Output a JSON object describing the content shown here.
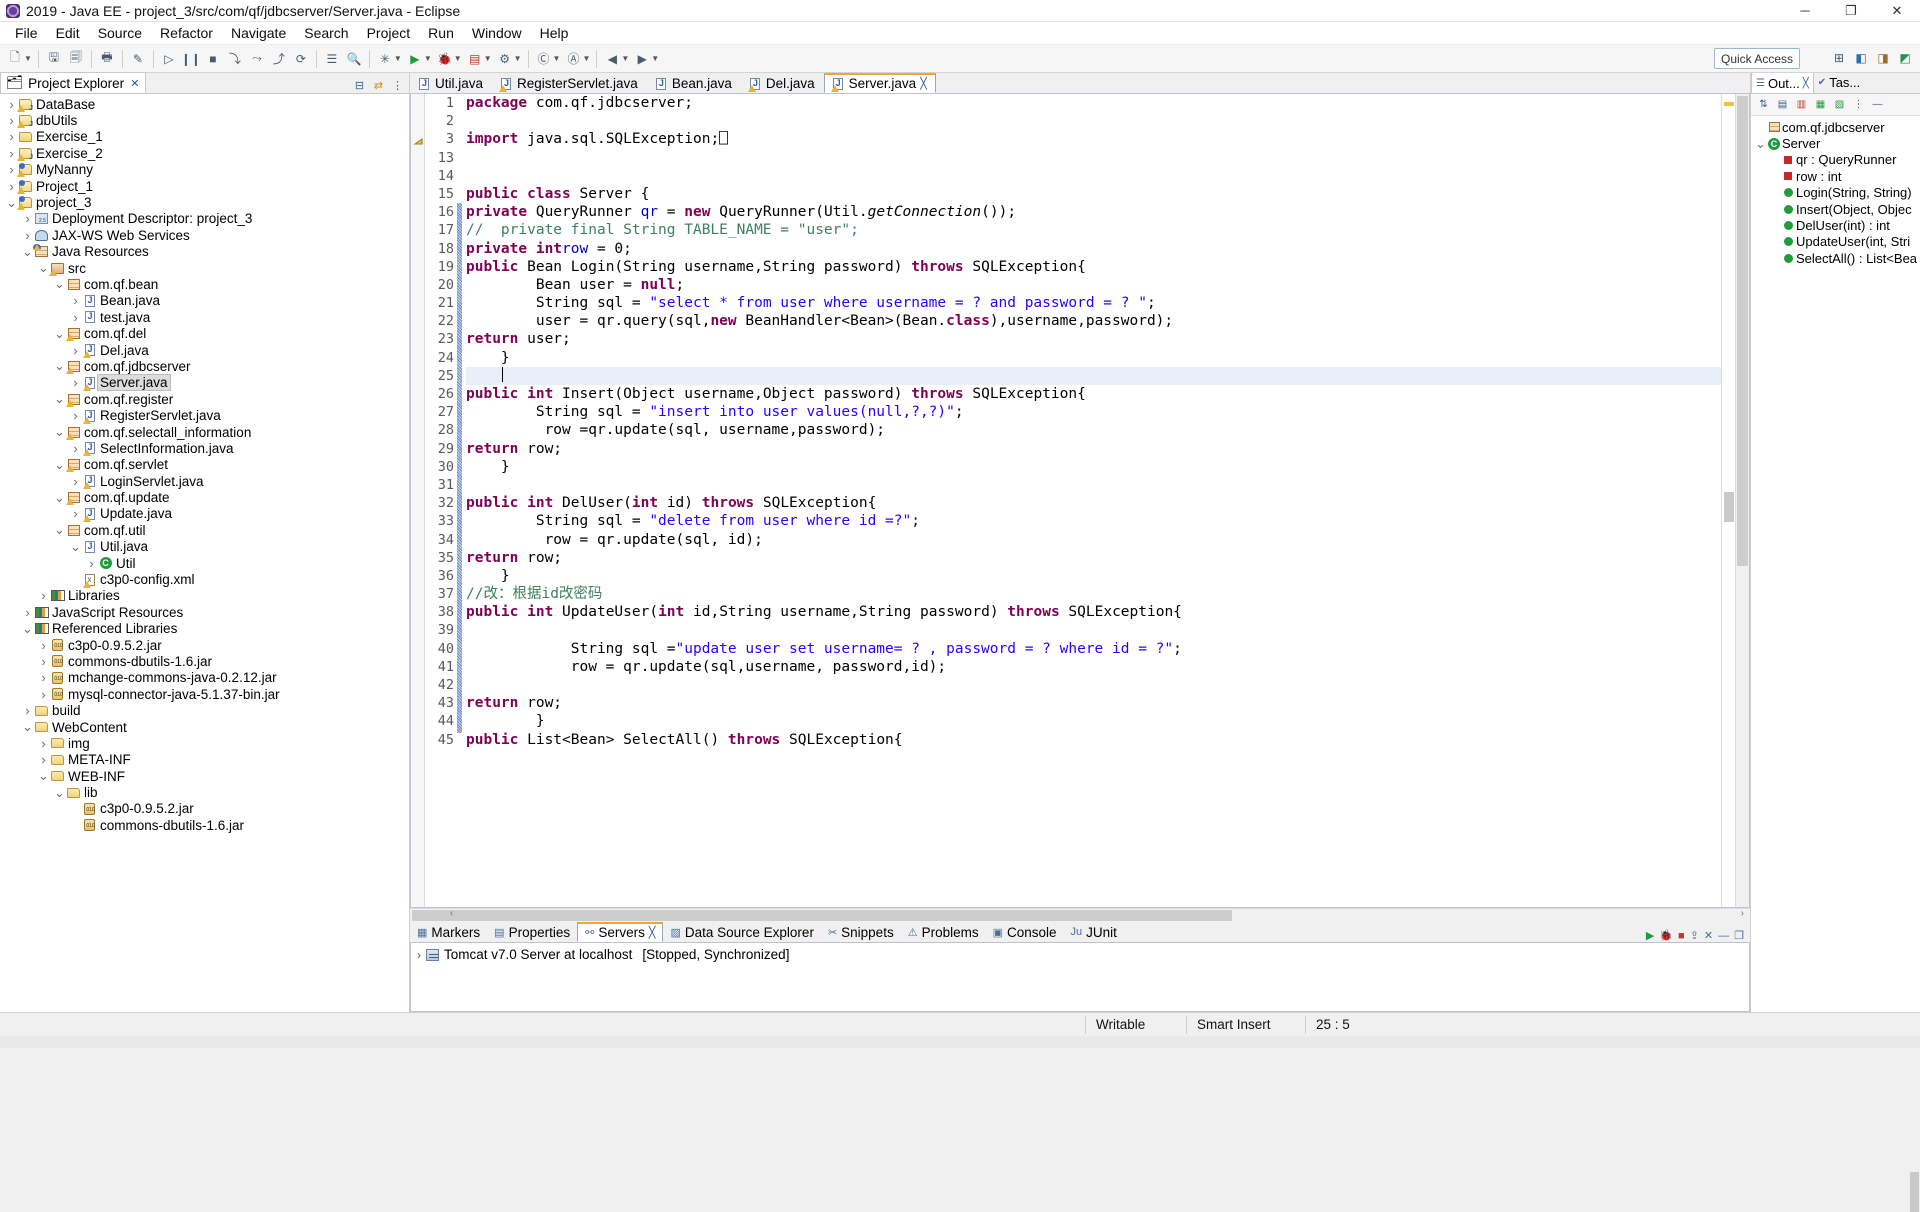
{
  "window": {
    "title": "2019 - Java EE - project_3/src/com/qf/jdbcserver/Server.java - Eclipse",
    "minimize": "─",
    "maximize": "❐",
    "close": "✕"
  },
  "menubar": [
    "File",
    "Edit",
    "Source",
    "Refactor",
    "Navigate",
    "Search",
    "Project",
    "Run",
    "Window",
    "Help"
  ],
  "toolbar": {
    "quick_access_placeholder": "Quick Access",
    "items": [
      "new-wizard-icon",
      "save-icon",
      "save-all-icon",
      "print-icon",
      "toggle-markoccurrences-icon",
      "debug-icon",
      "pause-icon",
      "stop-icon",
      "step-icon",
      "stepover-icon",
      "stepreturn-icon",
      "restart-icon",
      "open-type-icon",
      "search-icon",
      "new-java-package-icon",
      "run-icon",
      "debug-run-icon",
      "coverage-icon",
      "external-tools-icon",
      "new-java-class-icon",
      "back-icon",
      "forward-icon"
    ]
  },
  "explorer": {
    "tab_label": "Project Explorer",
    "tools": [
      "collapse-all-icon",
      "link-with-editor-icon",
      "view-menu-icon"
    ],
    "items": [
      {
        "label": "DataBase",
        "indent": 0,
        "arrow": "collapsed",
        "icon": "project-java-icon"
      },
      {
        "label": "dbUtils",
        "indent": 0,
        "arrow": "collapsed",
        "icon": "project-java-icon"
      },
      {
        "label": "Exercise_1",
        "indent": 0,
        "arrow": "collapsed",
        "icon": "folder-icon"
      },
      {
        "label": "Exercise_2",
        "indent": 0,
        "arrow": "collapsed",
        "icon": "project-java-icon"
      },
      {
        "label": "MyNanny",
        "indent": 0,
        "arrow": "collapsed",
        "icon": "project-web-icon"
      },
      {
        "label": "Project_1",
        "indent": 0,
        "arrow": "collapsed",
        "icon": "project-web-icon"
      },
      {
        "label": "project_3",
        "indent": 0,
        "arrow": "expanded",
        "icon": "project-web-icon"
      },
      {
        "label": "Deployment Descriptor: project_3",
        "indent": 1,
        "arrow": "collapsed",
        "icon": "deployment-descriptor-icon"
      },
      {
        "label": "JAX-WS Web Services",
        "indent": 1,
        "arrow": "collapsed",
        "icon": "web-services-icon"
      },
      {
        "label": "Java Resources",
        "indent": 1,
        "arrow": "expanded",
        "icon": "java-resources-icon"
      },
      {
        "label": "src",
        "indent": 2,
        "arrow": "expanded",
        "icon": "source-folder-icon"
      },
      {
        "label": "com.qf.bean",
        "indent": 3,
        "arrow": "expanded",
        "icon": "package-icon"
      },
      {
        "label": "Bean.java",
        "indent": 4,
        "arrow": "collapsed",
        "icon": "java-file-icon"
      },
      {
        "label": "test.java",
        "indent": 4,
        "arrow": "collapsed",
        "icon": "java-file-icon"
      },
      {
        "label": "com.qf.del",
        "indent": 3,
        "arrow": "expanded",
        "icon": "package-warning-icon"
      },
      {
        "label": "Del.java",
        "indent": 4,
        "arrow": "collapsed",
        "icon": "java-file-warning-icon"
      },
      {
        "label": "com.qf.jdbcserver",
        "indent": 3,
        "arrow": "expanded",
        "icon": "package-warning-icon"
      },
      {
        "label": "Server.java",
        "indent": 4,
        "arrow": "collapsed",
        "icon": "java-file-warning-icon",
        "selected": true
      },
      {
        "label": "com.qf.register",
        "indent": 3,
        "arrow": "expanded",
        "icon": "package-warning-icon"
      },
      {
        "label": "RegisterServlet.java",
        "indent": 4,
        "arrow": "collapsed",
        "icon": "java-file-warning-icon"
      },
      {
        "label": "com.qf.selectall_information",
        "indent": 3,
        "arrow": "expanded",
        "icon": "package-warning-icon"
      },
      {
        "label": "SelectInformation.java",
        "indent": 4,
        "arrow": "collapsed",
        "icon": "java-file-warning-icon"
      },
      {
        "label": "com.qf.servlet",
        "indent": 3,
        "arrow": "expanded",
        "icon": "package-warning-icon"
      },
      {
        "label": "LoginServlet.java",
        "indent": 4,
        "arrow": "collapsed",
        "icon": "java-file-warning-icon"
      },
      {
        "label": "com.qf.update",
        "indent": 3,
        "arrow": "expanded",
        "icon": "package-warning-icon"
      },
      {
        "label": "Update.java",
        "indent": 4,
        "arrow": "collapsed",
        "icon": "java-file-warning-icon"
      },
      {
        "label": "com.qf.util",
        "indent": 3,
        "arrow": "expanded",
        "icon": "package-icon"
      },
      {
        "label": "Util.java",
        "indent": 4,
        "arrow": "expanded",
        "icon": "java-file-icon"
      },
      {
        "label": "Util",
        "indent": 5,
        "arrow": "collapsed",
        "icon": "class-icon"
      },
      {
        "label": "c3p0-config.xml",
        "indent": 4,
        "arrow": "none",
        "icon": "xml-file-warning-icon"
      },
      {
        "label": "Libraries",
        "indent": 2,
        "arrow": "collapsed",
        "icon": "library-icon"
      },
      {
        "label": "JavaScript Resources",
        "indent": 1,
        "arrow": "collapsed",
        "icon": "library-icon"
      },
      {
        "label": "Referenced Libraries",
        "indent": 1,
        "arrow": "expanded",
        "icon": "library-icon"
      },
      {
        "label": "c3p0-0.9.5.2.jar",
        "indent": 2,
        "arrow": "collapsed",
        "icon": "jar-icon"
      },
      {
        "label": "commons-dbutils-1.6.jar",
        "indent": 2,
        "arrow": "collapsed",
        "icon": "jar-icon"
      },
      {
        "label": "mchange-commons-java-0.2.12.jar",
        "indent": 2,
        "arrow": "collapsed",
        "icon": "jar-icon"
      },
      {
        "label": "mysql-connector-java-5.1.37-bin.jar",
        "indent": 2,
        "arrow": "collapsed",
        "icon": "jar-icon"
      },
      {
        "label": "build",
        "indent": 1,
        "arrow": "collapsed",
        "icon": "folder-icon"
      },
      {
        "label": "WebContent",
        "indent": 1,
        "arrow": "expanded",
        "icon": "folder-icon"
      },
      {
        "label": "img",
        "indent": 2,
        "arrow": "collapsed",
        "icon": "folder-icon"
      },
      {
        "label": "META-INF",
        "indent": 2,
        "arrow": "collapsed",
        "icon": "folder-icon"
      },
      {
        "label": "WEB-INF",
        "indent": 2,
        "arrow": "expanded",
        "icon": "folder-icon"
      },
      {
        "label": "lib",
        "indent": 3,
        "arrow": "expanded",
        "icon": "folder-icon"
      },
      {
        "label": "c3p0-0.9.5.2.jar",
        "indent": 4,
        "arrow": "none",
        "icon": "jar-icon"
      },
      {
        "label": "commons-dbutils-1.6.jar",
        "indent": 4,
        "arrow": "none",
        "icon": "jar-icon"
      }
    ]
  },
  "editor": {
    "tabs": [
      {
        "label": "Util.java",
        "active": false,
        "warning": false
      },
      {
        "label": "RegisterServlet.java",
        "active": false,
        "warning": true
      },
      {
        "label": "Bean.java",
        "active": false,
        "warning": false
      },
      {
        "label": "Del.java",
        "active": false,
        "warning": true
      },
      {
        "label": "Server.java",
        "active": true,
        "warning": true,
        "close": "╳"
      }
    ],
    "lines": [
      {
        "n": "1",
        "fold": "",
        "marker": "",
        "html": "<span class=\"kw\">package</span> com.qf.jdbcserver;"
      },
      {
        "n": "2",
        "fold": "",
        "marker": "",
        "html": ""
      },
      {
        "n": "3",
        "fold": "⊕",
        "marker": "warning",
        "html": "<span class=\"kw\">import</span> java.sql.SQLException;⎕"
      },
      {
        "n": "13",
        "fold": "",
        "marker": "",
        "html": ""
      },
      {
        "n": "14",
        "fold": "",
        "marker": "",
        "html": ""
      },
      {
        "n": "15",
        "fold": "",
        "marker": "",
        "html": "<span class=\"kw\">public class</span> Server {"
      },
      {
        "n": "16",
        "fold": "",
        "marker": "",
        "html": "    <span class=\"kw\">private</span> QueryRunner <span class=\"fld\">qr</span> = <span class=\"kw\">new</span> QueryRunner(Util.<span class=\"stat\">getConnection</span>());"
      },
      {
        "n": "17",
        "fold": "",
        "marker": "",
        "html": "<span class=\"cmt\">//  private final String TABLE_NAME = \"user\";</span>"
      },
      {
        "n": "18",
        "fold": "",
        "marker": "",
        "html": "    <span class=\"kw\">private int</span> <span class=\"fld\">row</span> = 0;"
      },
      {
        "n": "19",
        "fold": "⊖",
        "marker": "",
        "html": "    <span class=\"kw\">public</span> Bean Login(String username,String password) <span class=\"kw\">throws</span> SQLException{"
      },
      {
        "n": "20",
        "fold": "",
        "marker": "",
        "html": "        Bean user = <span class=\"kw\">null</span>;"
      },
      {
        "n": "21",
        "fold": "",
        "marker": "",
        "html": "        String sql = <span class=\"str\">\"select * from user where username = ? and password = ? \"</span>;"
      },
      {
        "n": "22",
        "fold": "",
        "marker": "",
        "html": "        user = qr.query(sql,<span class=\"kw\">new</span> BeanHandler&lt;Bean&gt;(Bean.<span class=\"kw\">class</span>),username,password);"
      },
      {
        "n": "23",
        "fold": "",
        "marker": "",
        "html": "        <span class=\"kw\">return</span> user;"
      },
      {
        "n": "24",
        "fold": "",
        "marker": "",
        "html": "    }"
      },
      {
        "n": "25",
        "fold": "",
        "marker": "",
        "html": "",
        "current": true
      },
      {
        "n": "26",
        "fold": "⊖",
        "marker": "",
        "html": "    <span class=\"kw\">public int</span> Insert(Object username,Object password) <span class=\"kw\">throws</span> SQLException{"
      },
      {
        "n": "27",
        "fold": "",
        "marker": "",
        "html": "        String sql = <span class=\"str\">\"insert into user values(null,?,?)\"</span>;"
      },
      {
        "n": "28",
        "fold": "",
        "marker": "",
        "html": "         row =qr.update(sql, username,password);"
      },
      {
        "n": "29",
        "fold": "",
        "marker": "",
        "html": "        <span class=\"kw\">return</span> row;"
      },
      {
        "n": "30",
        "fold": "",
        "marker": "",
        "html": "    }"
      },
      {
        "n": "31",
        "fold": "",
        "marker": "",
        "html": ""
      },
      {
        "n": "32",
        "fold": "⊖",
        "marker": "",
        "html": "    <span class=\"kw\">public int</span> DelUser(<span class=\"kw\">int</span> id) <span class=\"kw\">throws</span> SQLException{"
      },
      {
        "n": "33",
        "fold": "",
        "marker": "",
        "html": "        String sql = <span class=\"str\">\"delete from user where id =?\"</span>;"
      },
      {
        "n": "34",
        "fold": "",
        "marker": "",
        "html": "         row = qr.update(sql, id);"
      },
      {
        "n": "35",
        "fold": "",
        "marker": "",
        "html": "         <span class=\"kw\">return</span> row;"
      },
      {
        "n": "36",
        "fold": "",
        "marker": "",
        "html": "    }"
      },
      {
        "n": "37",
        "fold": "",
        "marker": "",
        "html": "    <span class=\"cmt\">//改：根据id改密码</span>"
      },
      {
        "n": "38",
        "fold": "⊖",
        "marker": "",
        "html": "    <span class=\"kw\">public int</span> UpdateUser(<span class=\"kw\">int</span> id,String username,String password) <span class=\"kw\">throws</span> SQLException{"
      },
      {
        "n": "39",
        "fold": "",
        "marker": "",
        "html": ""
      },
      {
        "n": "40",
        "fold": "",
        "marker": "",
        "html": "            String sql =<span class=\"str\">\"update user set username= ? , password = ? where id = ?\"</span>;"
      },
      {
        "n": "41",
        "fold": "",
        "marker": "",
        "html": "            row = qr.update(sql,username, password,id);"
      },
      {
        "n": "42",
        "fold": "",
        "marker": "",
        "html": ""
      },
      {
        "n": "43",
        "fold": "",
        "marker": "",
        "html": "            <span class=\"kw\">return</span> row;"
      },
      {
        "n": "44",
        "fold": "",
        "marker": "",
        "html": "        }"
      },
      {
        "n": "45",
        "fold": "⊖",
        "marker": "",
        "html": "    <span class=\"kw\">public</span> List&lt;Bean&gt; SelectAll() <span class=\"kw\">throws</span> SQLException{"
      }
    ]
  },
  "bottom_panel": {
    "tabs": [
      {
        "label": "Markers",
        "icon": "markers-icon",
        "active": false
      },
      {
        "label": "Properties",
        "icon": "properties-icon",
        "active": false
      },
      {
        "label": "Servers",
        "icon": "servers-icon",
        "active": true,
        "close": "╳"
      },
      {
        "label": "Data Source Explorer",
        "icon": "datasource-icon",
        "active": false
      },
      {
        "label": "Snippets",
        "icon": "snippets-icon",
        "active": false
      },
      {
        "label": "Problems",
        "icon": "problems-icon",
        "active": false
      },
      {
        "label": "Console",
        "icon": "console-icon",
        "active": false
      },
      {
        "label": "JUnit",
        "icon": "junit-icon",
        "active": false
      }
    ],
    "tools": [
      "start-server-icon",
      "debug-server-icon",
      "stop-server-icon",
      "publish-icon",
      "remove-icon",
      "minimize-icon",
      "maximize-icon"
    ],
    "server_row": {
      "arrow": "›",
      "name": "Tomcat v7.0 Server at localhost",
      "status": "[Stopped, Synchronized]"
    }
  },
  "outline": {
    "tabs": [
      {
        "label": "Out...",
        "active": true,
        "close": "╳"
      },
      {
        "label": "Tas...",
        "active": false
      }
    ],
    "tools": [
      "sort-icon",
      "hide-fields-icon",
      "hide-static-icon",
      "hide-nonpublic-icon",
      "hide-local-icon",
      "view-menu-icon",
      "minimize-icon"
    ],
    "items": [
      {
        "label": "com.qf.jdbcserver",
        "indent": 0,
        "arrow": "none",
        "icon": "package-declaration-icon"
      },
      {
        "label": "Server",
        "indent": 0,
        "arrow": "expanded",
        "icon": "class-icon"
      },
      {
        "label": "qr : QueryRunner",
        "indent": 1,
        "arrow": "none",
        "icon": "private-field-icon"
      },
      {
        "label": "row : int",
        "indent": 1,
        "arrow": "none",
        "icon": "private-field-icon"
      },
      {
        "label": "Login(String, String)",
        "indent": 1,
        "arrow": "none",
        "icon": "public-method-icon"
      },
      {
        "label": "Insert(Object, Objec",
        "indent": 1,
        "arrow": "none",
        "icon": "public-method-icon"
      },
      {
        "label": "DelUser(int) : int",
        "indent": 1,
        "arrow": "none",
        "icon": "public-method-icon"
      },
      {
        "label": "UpdateUser(int, Stri",
        "indent": 1,
        "arrow": "none",
        "icon": "public-method-icon"
      },
      {
        "label": "SelectAll() : List<Bea",
        "indent": 1,
        "arrow": "none",
        "icon": "public-method-icon"
      }
    ]
  },
  "statusbar": {
    "writable": "Writable",
    "insert_mode": "Smart Insert",
    "position": "25 : 5"
  }
}
